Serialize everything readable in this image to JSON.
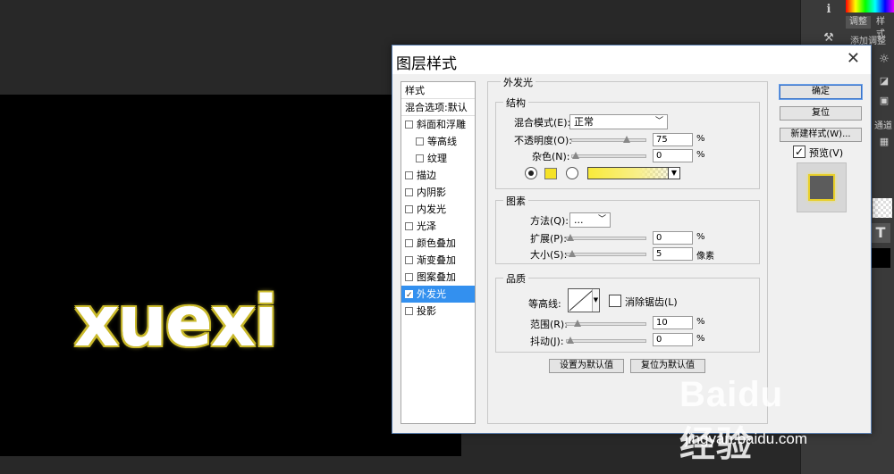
{
  "workspace": {
    "canvas_text": "xuexi"
  },
  "right_panel": {
    "tab_adjust": "调整",
    "tab_style": "样式",
    "add_adjust": "添加调整",
    "channel_label": "通道",
    "layer_type_glyph": "T"
  },
  "dialog": {
    "title": "图层样式",
    "close_glyph": "✕",
    "styles_list": {
      "header": "样式",
      "blend_options": "混合选项:默认",
      "items": [
        {
          "label": "斜面和浮雕",
          "checked": false,
          "sub": false
        },
        {
          "label": "等高线",
          "checked": false,
          "sub": true
        },
        {
          "label": "纹理",
          "checked": false,
          "sub": true
        },
        {
          "label": "描边",
          "checked": false,
          "sub": false
        },
        {
          "label": "内阴影",
          "checked": false,
          "sub": false
        },
        {
          "label": "内发光",
          "checked": false,
          "sub": false
        },
        {
          "label": "光泽",
          "checked": false,
          "sub": false
        },
        {
          "label": "颜色叠加",
          "checked": false,
          "sub": false
        },
        {
          "label": "渐变叠加",
          "checked": false,
          "sub": false
        },
        {
          "label": "图案叠加",
          "checked": false,
          "sub": false
        },
        {
          "label": "外发光",
          "checked": true,
          "sub": false,
          "active": true
        },
        {
          "label": "投影",
          "checked": false,
          "sub": false
        }
      ]
    },
    "outer_glow": {
      "title": "外发光",
      "structure": {
        "title": "结构",
        "blend_mode_label": "混合模式(E):",
        "blend_mode_value": "正常",
        "opacity_label": "不透明度(O):",
        "opacity_value": "75",
        "opacity_unit": "%",
        "opacity_fraction": 0.75,
        "noise_label": "杂色(N):",
        "noise_value": "0",
        "noise_unit": "%",
        "noise_fraction": 0.0,
        "glow_color": "#f5e227"
      },
      "elements": {
        "title": "图素",
        "method_label": "方法(Q):",
        "method_value": "...",
        "spread_label": "扩展(P):",
        "spread_value": "0",
        "spread_unit": "%",
        "spread_fraction": 0.0,
        "size_label": "大小(S):",
        "size_value": "5",
        "size_unit": "像素",
        "size_fraction": 0.02
      },
      "quality": {
        "title": "品质",
        "contour_label": "等高线:",
        "antialias_label": "消除锯齿(L)",
        "range_label": "范围(R):",
        "range_value": "10",
        "range_unit": "%",
        "range_fraction": 0.1,
        "jitter_label": "抖动(J):",
        "jitter_value": "0",
        "jitter_unit": "%",
        "jitter_fraction": 0.0
      },
      "set_default_label": "设置为默认值",
      "reset_default_label": "复位为默认值"
    },
    "buttons": {
      "ok": "确定",
      "reset": "复位",
      "new_style": "新建样式(W)...",
      "preview_label": "预览(V)"
    }
  },
  "watermark": {
    "logo": "Baidu经验",
    "site": "jingyan.baidu.com"
  }
}
